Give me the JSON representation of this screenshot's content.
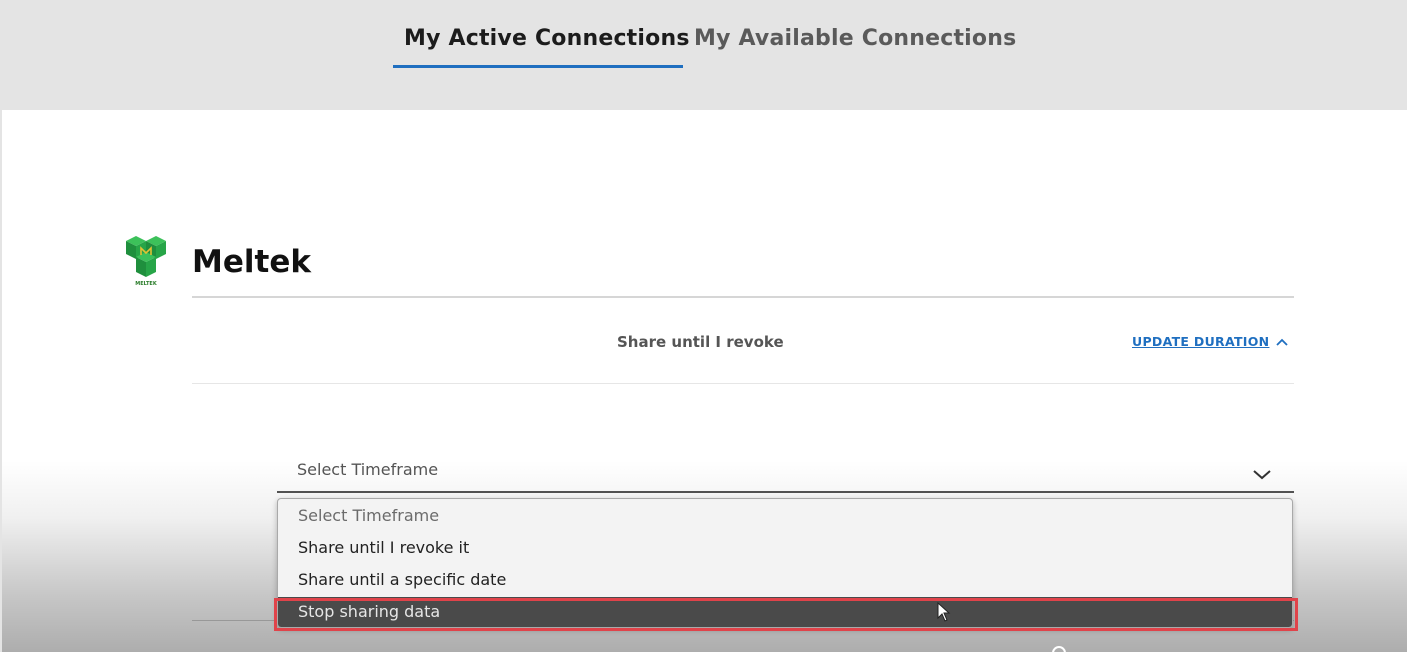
{
  "tabs": {
    "active_label": "My Active Connections",
    "inactive_label": "My Available Connections"
  },
  "connection": {
    "company_name": "Meltek",
    "logo_caption": "MELTEK",
    "duration_text": "Share until I revoke",
    "update_link_label": "UPDATE DURATION"
  },
  "timeframe": {
    "label": "Select Timeframe",
    "options": [
      "Select Timeframe",
      "Share until I revoke it",
      "Share until a specific date",
      "Stop sharing data"
    ],
    "highlighted_option": "Stop sharing data"
  },
  "colors": {
    "accent_blue": "#1f6fc0",
    "highlight_red": "#e0434a",
    "logo_green": "#2fa84f"
  },
  "icons": {
    "logo": "meltek-cube-logo-icon",
    "collapse": "chevron-up-icon",
    "expand": "chevron-down-icon",
    "cursor": "mouse-pointer-icon"
  }
}
